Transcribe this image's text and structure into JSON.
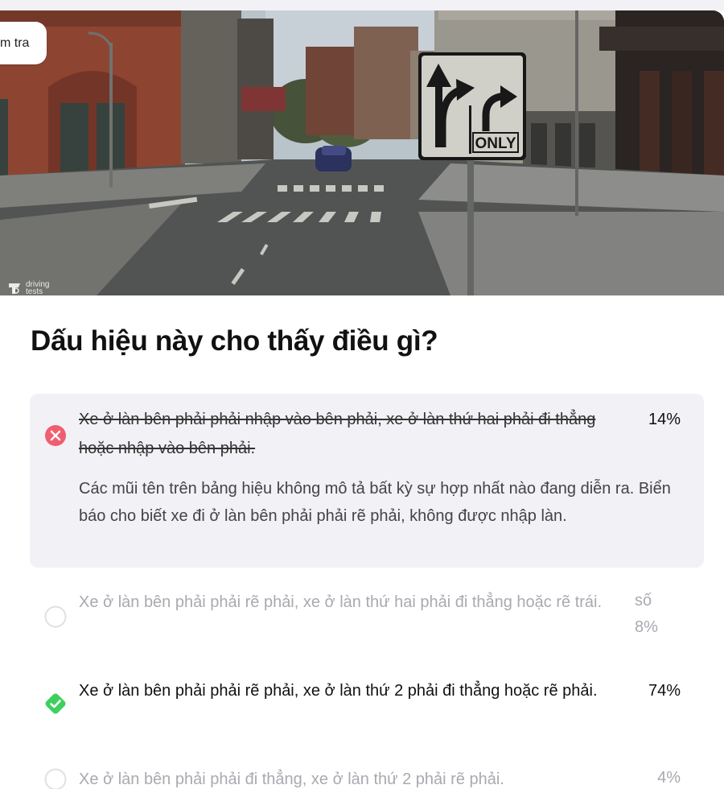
{
  "header": {
    "tab_label": "m tra"
  },
  "image": {
    "sign_text": "ONLY",
    "watermark_line1": "driving",
    "watermark_line2": "tests"
  },
  "question": {
    "title": "Dấu hiệu này cho thấy điều gì?"
  },
  "answers": [
    {
      "text": "Xe ở làn bên phải phải nhập vào bên phải, xe ở làn thứ hai phải đi thẳng hoặc nhập vào bên phải.",
      "percent": "14%",
      "state": "incorrect-selected",
      "explanation": "Các mũi tên trên bảng hiệu không mô tả bất kỳ sự hợp nhất nào đang diễn ra. Biển báo cho biết xe đi ở làn bên phải phải rẽ phải, không được nhập làn."
    },
    {
      "text": "Xe ở làn bên phải phải rẽ phải, xe ở làn thứ hai phải đi thẳng hoặc rẽ trái.",
      "percent": "số 8%",
      "state": "unselected"
    },
    {
      "text": "Xe ở làn bên phải phải rẽ phải, xe ở làn thứ 2 phải đi thẳng hoặc rẽ phải.",
      "percent": "74%",
      "state": "correct"
    },
    {
      "text": "Xe ở làn bên phải phải đi thẳng, xe ở làn thứ 2 phải rẽ phải.",
      "percent": "4%",
      "state": "unselected"
    }
  ],
  "colors": {
    "incorrect": "#ef5f6f",
    "correct": "#3ecf5e",
    "selected_bg": "#f1f1f6",
    "muted_text": "#a9a9b0"
  }
}
